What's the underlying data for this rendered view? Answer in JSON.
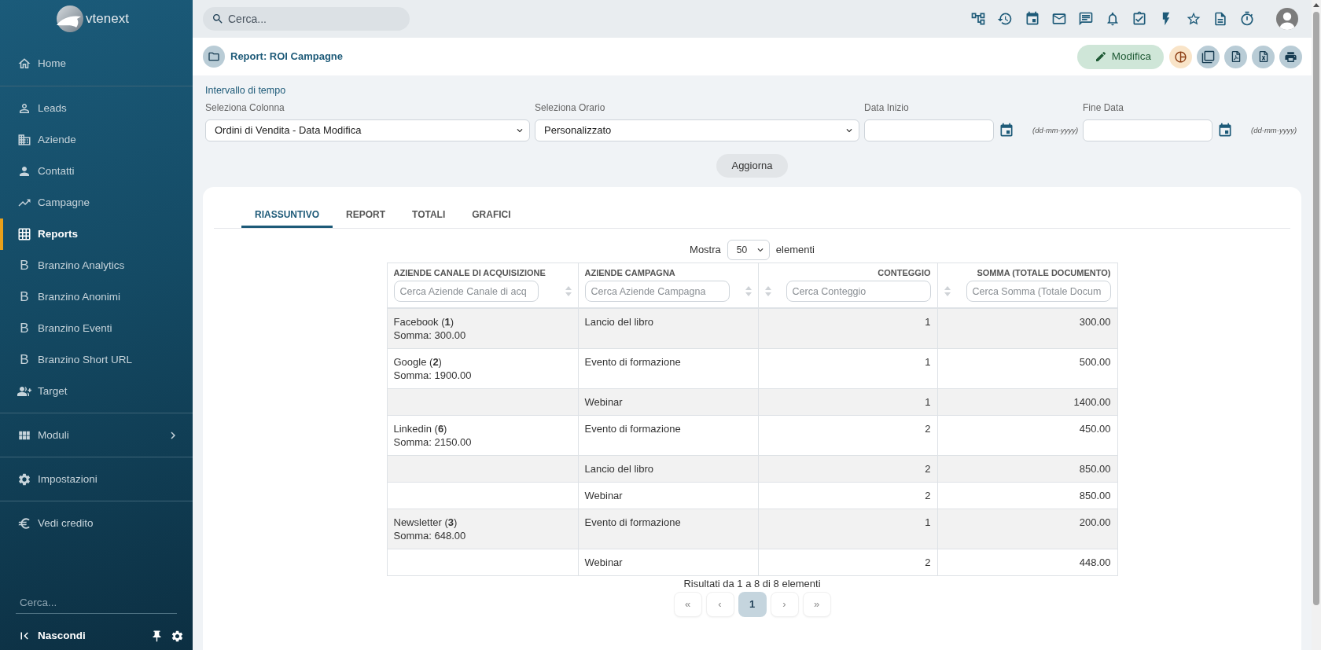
{
  "sidebar": {
    "logo": "vtenext",
    "sections": [
      {
        "items": [
          {
            "label": "Home",
            "kind": "icon",
            "selected": false,
            "submenu": false
          }
        ]
      },
      {
        "items": [
          {
            "label": "Leads",
            "kind": "icon",
            "selected": false,
            "submenu": false
          },
          {
            "label": "Aziende",
            "kind": "icon",
            "selected": false,
            "submenu": false
          },
          {
            "label": "Contatti",
            "kind": "icon",
            "selected": false,
            "submenu": false
          },
          {
            "label": "Campagne",
            "kind": "icon",
            "selected": false,
            "submenu": false
          },
          {
            "label": "Reports",
            "kind": "icon",
            "selected": true,
            "submenu": false
          },
          {
            "label": "Branzino Analytics",
            "kind": "letter",
            "letter": "B",
            "selected": false,
            "submenu": false
          },
          {
            "label": "Branzino Anonimi",
            "kind": "letter",
            "letter": "B",
            "selected": false,
            "submenu": false
          },
          {
            "label": "Branzino Eventi",
            "kind": "letter",
            "letter": "B",
            "selected": false,
            "submenu": false
          },
          {
            "label": "Branzino Short URL",
            "kind": "letter",
            "letter": "B",
            "selected": false,
            "submenu": false
          },
          {
            "label": "Target",
            "kind": "icon",
            "selected": false,
            "submenu": false
          }
        ]
      },
      {
        "items": [
          {
            "label": "Moduli",
            "kind": "icon",
            "selected": false,
            "submenu": true
          }
        ]
      },
      {
        "items": [
          {
            "label": "Impostazioni",
            "kind": "icon",
            "selected": false,
            "submenu": false
          }
        ]
      },
      {
        "items": [
          {
            "label": "Vedi credito",
            "kind": "icon",
            "selected": false,
            "submenu": false
          }
        ]
      }
    ],
    "search": {
      "placeholder": "Cerca..."
    },
    "collapse": {
      "label": "Nascondi"
    }
  },
  "topbar": {
    "search": {
      "placeholder": "Cerca..."
    }
  },
  "header": {
    "title": "Report: ROI Campagne",
    "edit": "Modifica"
  },
  "filters": {
    "title": "Intervallo di tempo",
    "fields": [
      {
        "kind": "select",
        "label": "Seleziona Colonna",
        "value": "Ordini di Vendita - Data Modifica"
      },
      {
        "kind": "select",
        "label": "Seleziona Orario",
        "value": "Personalizzato"
      },
      {
        "kind": "date",
        "label": "Data Inizio",
        "hint": "(dd-mm-yyyy)"
      },
      {
        "kind": "date",
        "label": "Fine Data",
        "hint": "(dd-mm-yyyy)"
      }
    ],
    "button": "Aggiorna"
  },
  "tabs": [
    {
      "label": "RIASSUNTIVO",
      "selected": true
    },
    {
      "label": "REPORT",
      "selected": false
    },
    {
      "label": "TOTALI",
      "selected": false
    },
    {
      "label": "GRAFICI",
      "selected": false
    }
  ],
  "table": {
    "length": {
      "label": "Mostra",
      "value": "50",
      "suffix": "elementi"
    },
    "columns": [
      {
        "title": "AZIENDE CANALE DI ACQUISIZIONE",
        "placeholder": "Cerca Aziende Canale di acq",
        "kind": "text"
      },
      {
        "title": "AZIENDE CAMPAGNA",
        "placeholder": "Cerca Aziende Campagna",
        "kind": "text"
      },
      {
        "title": "CONTEGGIO",
        "placeholder": "Cerca Conteggio",
        "kind": "number"
      },
      {
        "title": "SOMMA (TOTALE DOCUMENTO)",
        "placeholder": "Cerca Somma (Totale Docum",
        "kind": "number"
      }
    ],
    "rows": [
      {
        "cells": [
          "Facebook (**1**)\nSomma: 300.00",
          "Lancio del libro",
          "1",
          "300.00"
        ]
      },
      {
        "cells": [
          "Google (**2**)\nSomma: 1900.00",
          "Evento di formazione",
          "1",
          "500.00"
        ]
      },
      {
        "cells": [
          "",
          "Webinar",
          "1",
          "1400.00"
        ]
      },
      {
        "cells": [
          "Linkedin (**6**)\nSomma: 2150.00",
          "Evento di formazione",
          "2",
          "450.00"
        ]
      },
      {
        "cells": [
          "",
          "Lancio del libro",
          "2",
          "850.00"
        ]
      },
      {
        "cells": [
          "",
          "Webinar",
          "2",
          "850.00"
        ]
      },
      {
        "cells": [
          "Newsletter (**3**)\nSomma: 648.00",
          "Evento di formazione",
          "1",
          "200.00"
        ]
      },
      {
        "cells": [
          "",
          "Webinar",
          "2",
          "448.00"
        ]
      }
    ],
    "info": "Risultati da 1 a 8 di 8 elementi",
    "pagination": [
      {
        "label": "«",
        "selected": false
      },
      {
        "label": "‹",
        "selected": false
      },
      {
        "label": "1",
        "selected": true
      },
      {
        "label": "›",
        "selected": false
      },
      {
        "label": "»",
        "selected": false
      }
    ]
  }
}
